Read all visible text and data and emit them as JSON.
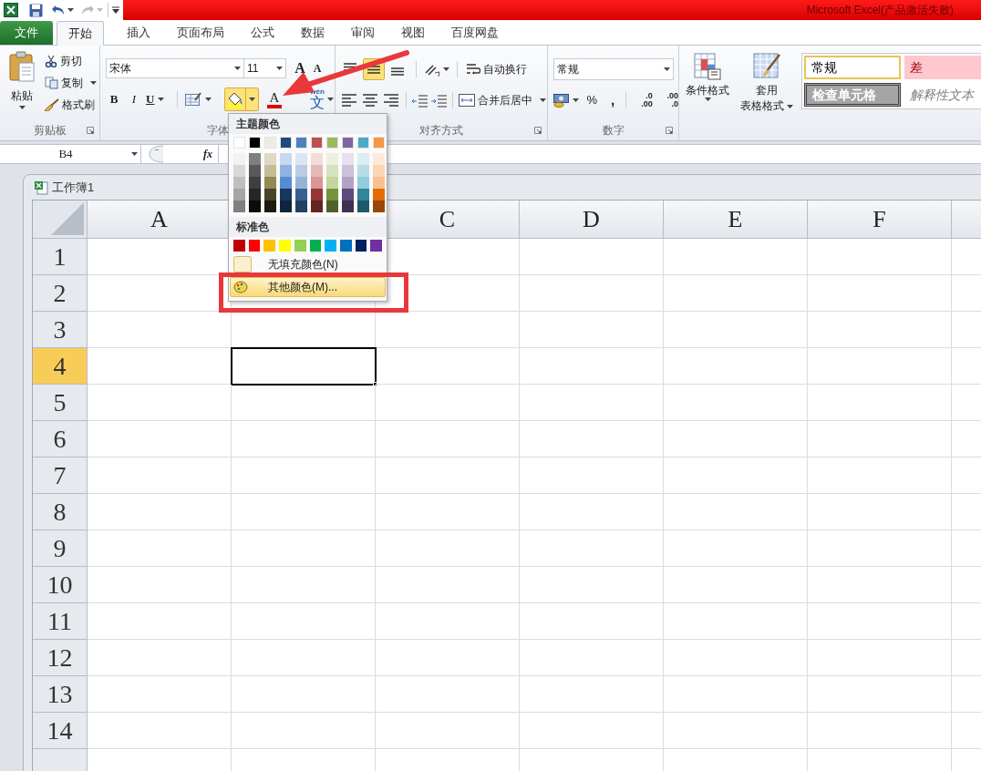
{
  "title_bar": {
    "title": "Microsoft Excel(产品激活失败)"
  },
  "tabs": [
    {
      "label": "文件",
      "kind": "file",
      "selected": false
    },
    {
      "label": "开始",
      "kind": "tab",
      "selected": true
    },
    {
      "label": "插入",
      "kind": "tab",
      "selected": false
    },
    {
      "label": "页面布局",
      "kind": "tab",
      "selected": false
    },
    {
      "label": "公式",
      "kind": "tab",
      "selected": false
    },
    {
      "label": "数据",
      "kind": "tab",
      "selected": false
    },
    {
      "label": "审阅",
      "kind": "tab",
      "selected": false
    },
    {
      "label": "视图",
      "kind": "tab",
      "selected": false
    },
    {
      "label": "百度网盘",
      "kind": "tab",
      "selected": false
    }
  ],
  "ribbon": {
    "clipboard": {
      "label": "剪贴板",
      "paste": "粘贴",
      "cut": "剪切",
      "copy": "复制",
      "format_painter": "格式刷"
    },
    "font": {
      "label": "字体",
      "font_name": "宋体",
      "font_size": "11",
      "grow": "A",
      "shrink": "A",
      "bold": "B",
      "italic": "I",
      "underline": "U",
      "fill_pressed": true,
      "font_color_letter": "A",
      "phonetic_ruby": "wén",
      "phonetic_base": "文"
    },
    "alignment": {
      "label": "对齐方式",
      "vertical_align": [
        {
          "selected": false
        },
        {
          "selected": true
        },
        {
          "selected": false
        }
      ],
      "wrap_text": "自动换行",
      "merge_center": "合并后居中"
    },
    "number": {
      "label": "数字",
      "format": "常规",
      "percent": "%",
      "comma": ",",
      "increase_decimal": [
        ".0",
        ".00"
      ],
      "decrease_decimal": [
        ".00",
        ".0"
      ]
    },
    "styles": {
      "conditional_format": "条件格式",
      "table_format": [
        "套用",
        "表格格式"
      ],
      "cell_styles": [
        {
          "kind": "normal",
          "label": "常规"
        },
        {
          "kind": "bad",
          "label": "差"
        },
        {
          "kind": "check",
          "label": "检查单元格"
        },
        {
          "kind": "explanatory",
          "label": "解释性文本"
        }
      ]
    }
  },
  "formula_bar": {
    "name_box": "B4",
    "fx": "fx"
  },
  "workbook": {
    "title": "工作簿1",
    "columns": [
      {
        "kind": "labeled",
        "label": "A",
        "selected": false
      },
      {
        "kind": "covered",
        "selected": true
      },
      {
        "kind": "labeled",
        "label": "C",
        "selected": false
      },
      {
        "kind": "labeled",
        "label": "D",
        "selected": false
      },
      {
        "kind": "labeled",
        "label": "E",
        "selected": false
      },
      {
        "kind": "labeled",
        "label": "F",
        "selected": false
      },
      {
        "kind": "blank",
        "selected": false
      }
    ],
    "rows": [
      {
        "label": "1",
        "selected": false
      },
      {
        "label": "2",
        "selected": false
      },
      {
        "label": "3",
        "selected": false
      },
      {
        "label": "4",
        "selected": true
      },
      {
        "label": "5",
        "selected": false
      },
      {
        "label": "6",
        "selected": false
      },
      {
        "label": "7",
        "selected": false
      },
      {
        "label": "8",
        "selected": false
      },
      {
        "label": "9",
        "selected": false
      },
      {
        "label": "10",
        "selected": false
      },
      {
        "label": "11",
        "selected": false
      },
      {
        "label": "12",
        "selected": false
      },
      {
        "label": "13",
        "selected": false
      },
      {
        "label": "14",
        "selected": false
      }
    ]
  },
  "palette": {
    "theme_heading": "主题颜色",
    "theme_colors": [
      {
        "color": "#ffffff",
        "shades": [
          {
            "color": "#f2f2f2"
          },
          {
            "color": "#d8d8d8"
          },
          {
            "color": "#bfbfbf"
          },
          {
            "color": "#a5a5a5"
          },
          {
            "color": "#7f7f7f"
          }
        ]
      },
      {
        "color": "#000000",
        "shades": [
          {
            "color": "#7f7f7f"
          },
          {
            "color": "#595959"
          },
          {
            "color": "#3f3f3f"
          },
          {
            "color": "#262626"
          },
          {
            "color": "#0c0c0c"
          }
        ]
      },
      {
        "color": "#eeece1",
        "shades": [
          {
            "color": "#ddd9c3"
          },
          {
            "color": "#c4bd97"
          },
          {
            "color": "#938953"
          },
          {
            "color": "#494429"
          },
          {
            "color": "#1d1b10"
          }
        ]
      },
      {
        "color": "#1f497d",
        "shades": [
          {
            "color": "#c6d9f0"
          },
          {
            "color": "#8db3e2"
          },
          {
            "color": "#548dd4"
          },
          {
            "color": "#17365d"
          },
          {
            "color": "#0f243e"
          }
        ]
      },
      {
        "color": "#4f81bd",
        "shades": [
          {
            "color": "#dbe5f1"
          },
          {
            "color": "#b8cce4"
          },
          {
            "color": "#95b3d7"
          },
          {
            "color": "#366092"
          },
          {
            "color": "#244061"
          }
        ]
      },
      {
        "color": "#c0504d",
        "shades": [
          {
            "color": "#f2dcdb"
          },
          {
            "color": "#e5b9b7"
          },
          {
            "color": "#d99694"
          },
          {
            "color": "#953734"
          },
          {
            "color": "#632423"
          }
        ]
      },
      {
        "color": "#9bbb59",
        "shades": [
          {
            "color": "#ebf1dd"
          },
          {
            "color": "#d7e3bc"
          },
          {
            "color": "#c3d69b"
          },
          {
            "color": "#76923c"
          },
          {
            "color": "#4f6128"
          }
        ]
      },
      {
        "color": "#8064a2",
        "shades": [
          {
            "color": "#e5e0ec"
          },
          {
            "color": "#ccc1d9"
          },
          {
            "color": "#b2a2c7"
          },
          {
            "color": "#5f497a"
          },
          {
            "color": "#3f3151"
          }
        ]
      },
      {
        "color": "#4bacc6",
        "shades": [
          {
            "color": "#dbeef3"
          },
          {
            "color": "#b7dde8"
          },
          {
            "color": "#92cddc"
          },
          {
            "color": "#31859b"
          },
          {
            "color": "#205867"
          }
        ]
      },
      {
        "color": "#f79646",
        "shades": [
          {
            "color": "#fdeada"
          },
          {
            "color": "#fbd5b5"
          },
          {
            "color": "#fac08f"
          },
          {
            "color": "#e36c09"
          },
          {
            "color": "#974806"
          }
        ]
      }
    ],
    "standard_heading": "标准色",
    "standard_colors": [
      {
        "color": "#c00000"
      },
      {
        "color": "#ff0000"
      },
      {
        "color": "#ffc000"
      },
      {
        "color": "#ffff00"
      },
      {
        "color": "#92d050"
      },
      {
        "color": "#00b050"
      },
      {
        "color": "#00b0f0"
      },
      {
        "color": "#0070c0"
      },
      {
        "color": "#002060"
      },
      {
        "color": "#7030a0"
      }
    ],
    "items": [
      {
        "label": "无填充颜色(N)",
        "kind": "no_fill",
        "selected": false
      },
      {
        "label": "其他颜色(M)...",
        "kind": "more",
        "selected": true
      }
    ]
  },
  "annotations": {
    "arrow": true,
    "highlight_frame": true
  }
}
